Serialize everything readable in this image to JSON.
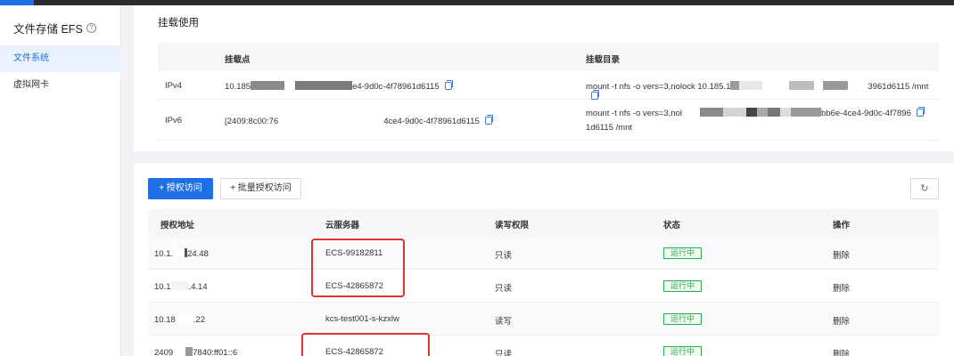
{
  "sidebar": {
    "title": "文件存储 EFS",
    "items": [
      {
        "label": "文件系统",
        "active": true
      },
      {
        "label": "虚拟网卡",
        "active": false
      }
    ]
  },
  "mount": {
    "section_title": "挂载使用",
    "headers": {
      "point": "挂载点",
      "dir": "挂载目录"
    },
    "rows": [
      {
        "type": "IPv4",
        "point_prefix": "10.185",
        "point_suffix": "e4-9d0c-4f78961d6115",
        "dir_prefix": "mount -t nfs -o vers=3,nolock 10.185.1",
        "dir_suffix": "3961d6115 /mnt"
      },
      {
        "type": "IPv6",
        "point_prefix": "[2409:8c00:76",
        "point_suffix": "4ce4-9d0c-4f78961d6115",
        "dir_prefix": "mount -t nfs -o vers=3,nol",
        "dir_suffix": "bb6e-4ce4-9d0c-4f7896",
        "dir_line2": "1d6115 /mnt"
      }
    ]
  },
  "toolbar": {
    "grant_label": "+ 授权访问",
    "batch_label": "+ 批量授权访问",
    "refresh_icon": "refresh-icon"
  },
  "auth": {
    "headers": {
      "addr": "授权地址",
      "server": "云服务器",
      "perm": "读写权限",
      "status": "状态",
      "action": "操作"
    },
    "rows": [
      {
        "addr_prefix": "10.1.",
        "addr_suffix": "24.48",
        "server": "ECS-99182811",
        "perm": "只读",
        "status": "运行中",
        "action": "删除"
      },
      {
        "addr_prefix": "10.1",
        "addr_suffix": ".4.14",
        "server": "ECS-42865872",
        "perm": "只读",
        "status": "运行中",
        "action": "删除"
      },
      {
        "addr_prefix": "10.18",
        "addr_suffix": ".22",
        "server": "kcs-test001-s-kzxlw",
        "perm": "读写",
        "status": "运行中",
        "action": "删除"
      },
      {
        "addr_prefix": "2409",
        "addr_suffix": "7840:ff01::6",
        "server": "ECS-42865872",
        "perm": "只读",
        "status": "运行中",
        "action": "删除"
      }
    ]
  },
  "colors": {
    "accent": "#1f6fe5",
    "status_green": "#2fa84f",
    "highlight_red": "#e0342f"
  }
}
